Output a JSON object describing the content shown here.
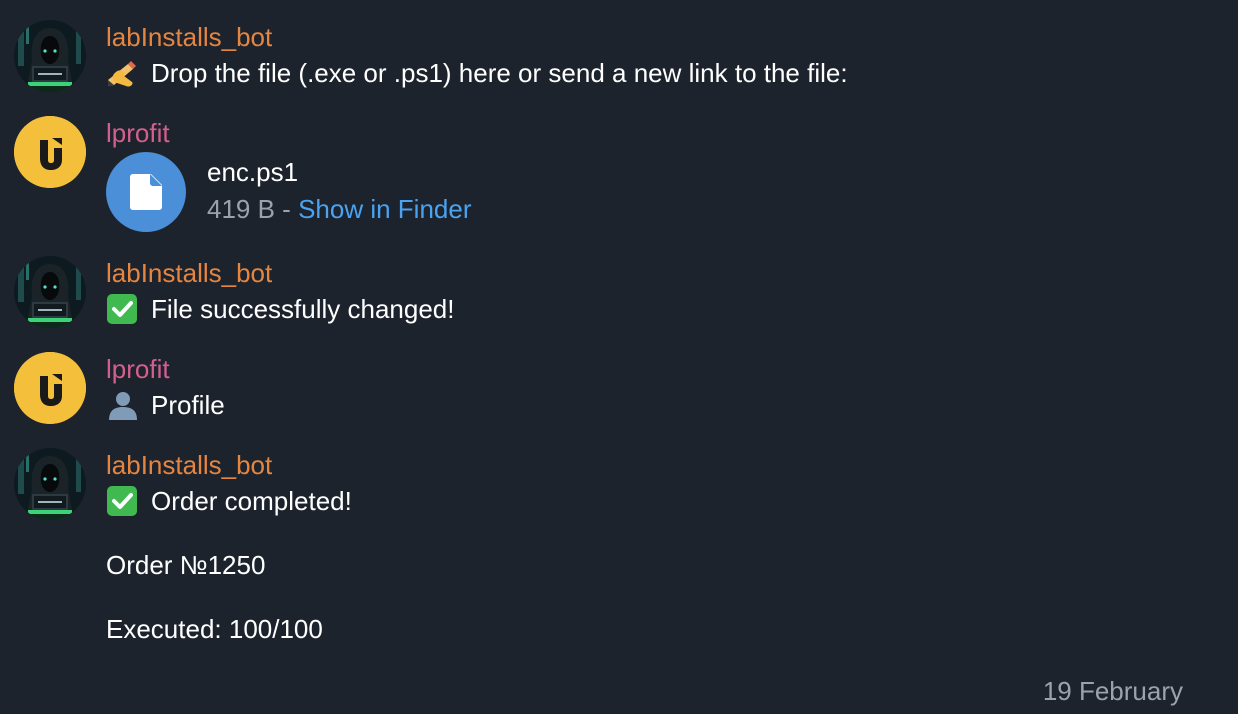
{
  "messages": [
    {
      "sender": "labInstalls_bot",
      "avatar_icon": "hacker-avatar-icon",
      "emoji_icon": "writing-hand-emoji",
      "text": "Drop the file (.exe or .ps1) here or send a new link to the file:"
    },
    {
      "sender": "lprofit",
      "avatar_icon": "lprofit-logo-icon",
      "file": {
        "icon": "file-icon",
        "name": "enc.ps1",
        "size": "419 B",
        "separator": " - ",
        "action": "Show in Finder"
      }
    },
    {
      "sender": "labInstalls_bot",
      "avatar_icon": "hacker-avatar-icon",
      "emoji_icon": "check-mark-emoji",
      "text": "File successfully changed!"
    },
    {
      "sender": "lprofit",
      "avatar_icon": "lprofit-logo-icon",
      "emoji_icon": "bust-silhouette-emoji",
      "text": "Profile"
    },
    {
      "sender": "labInstalls_bot",
      "avatar_icon": "hacker-avatar-icon",
      "emoji_icon": "check-mark-emoji",
      "text": "Order completed!",
      "line2": "Order №1250",
      "line3": "Executed: 100/100"
    }
  ],
  "date_separator": "19 February",
  "colors": {
    "background": "#1c232c",
    "bot_name": "#e5853f",
    "user_name": "#d45f8f",
    "link": "#4aa3f0",
    "muted": "#9aa3ad",
    "file_icon_bg": "#4a8fd8",
    "user_avatar_bg": "#f4bf3a",
    "check_green": "#3fb950"
  }
}
